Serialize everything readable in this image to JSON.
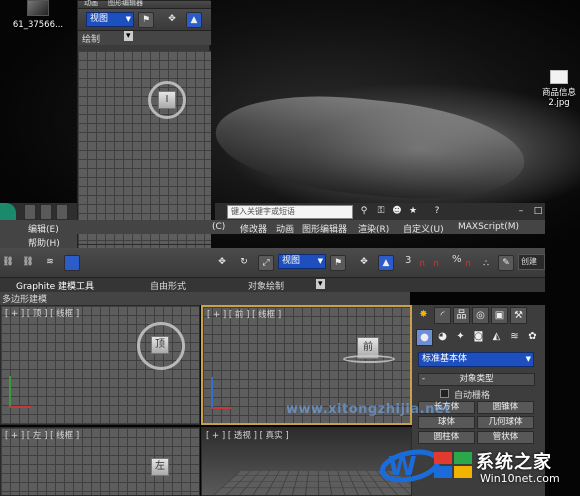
{
  "desktop": {
    "icon_left_label": "61_37566...",
    "icon_right_label_1": "商品信息",
    "icon_right_label_2": "2.jpg"
  },
  "back_window": {
    "dropdown_value": "视图",
    "menu_partial_1": "动画",
    "menu_partial_2": "图形编辑器",
    "freeform_label": "绘制",
    "freeform_dropdown": "▾"
  },
  "main_window": {
    "search_placeholder": "键入关键字或短语",
    "menu": {
      "c_item": "(C)",
      "modifiers": "修改器",
      "animation": "动画",
      "graph_editors": "图形编辑器",
      "rendering": "渲染(R)",
      "customize": "自定义(U)",
      "maxscript": "MAXScript(M)",
      "edit": "编辑(E)",
      "help": "帮助(H)"
    },
    "toolbar": {
      "view_dropdown": "视图",
      "snap_value": "3",
      "percent_icon": "%",
      "create_selection": "创建"
    },
    "ribbon": {
      "graphite_tab": "Graphite 建模工具",
      "freeform_tab": "自由形式",
      "object_paint_tab": "对象绘制",
      "polygon_modeling": "多边形建模"
    },
    "viewports": {
      "top_label": "[ + ] [ 顶 ] [ 线框 ]",
      "front_label": "[ + ] [ 前 ] [ 线框 ]",
      "left_label": "[ + ] [ 左 ] [ 线框 ]",
      "perspective_label": "[ + ] [ 透视 ] [ 真实 ]",
      "cube_top": "顶",
      "cube_front": "前",
      "cube_left": "左"
    },
    "command_panel": {
      "category_dropdown": "标准基本体",
      "rollout_title": "对象类型",
      "autogrid_label": "自动栅格",
      "buttons": [
        "长方体",
        "圆锥体",
        "球体",
        "几何球体",
        "圆柱体",
        "管状体"
      ]
    }
  },
  "watermark": {
    "brand": "系统之家",
    "url": "Win10net.com",
    "overlay_text": "www.xitongzhijia.net"
  },
  "colors": {
    "accent_blue": "#1e4fbf",
    "active_border": "#c8a24a",
    "viewport_grid": "#5d5d5d"
  }
}
